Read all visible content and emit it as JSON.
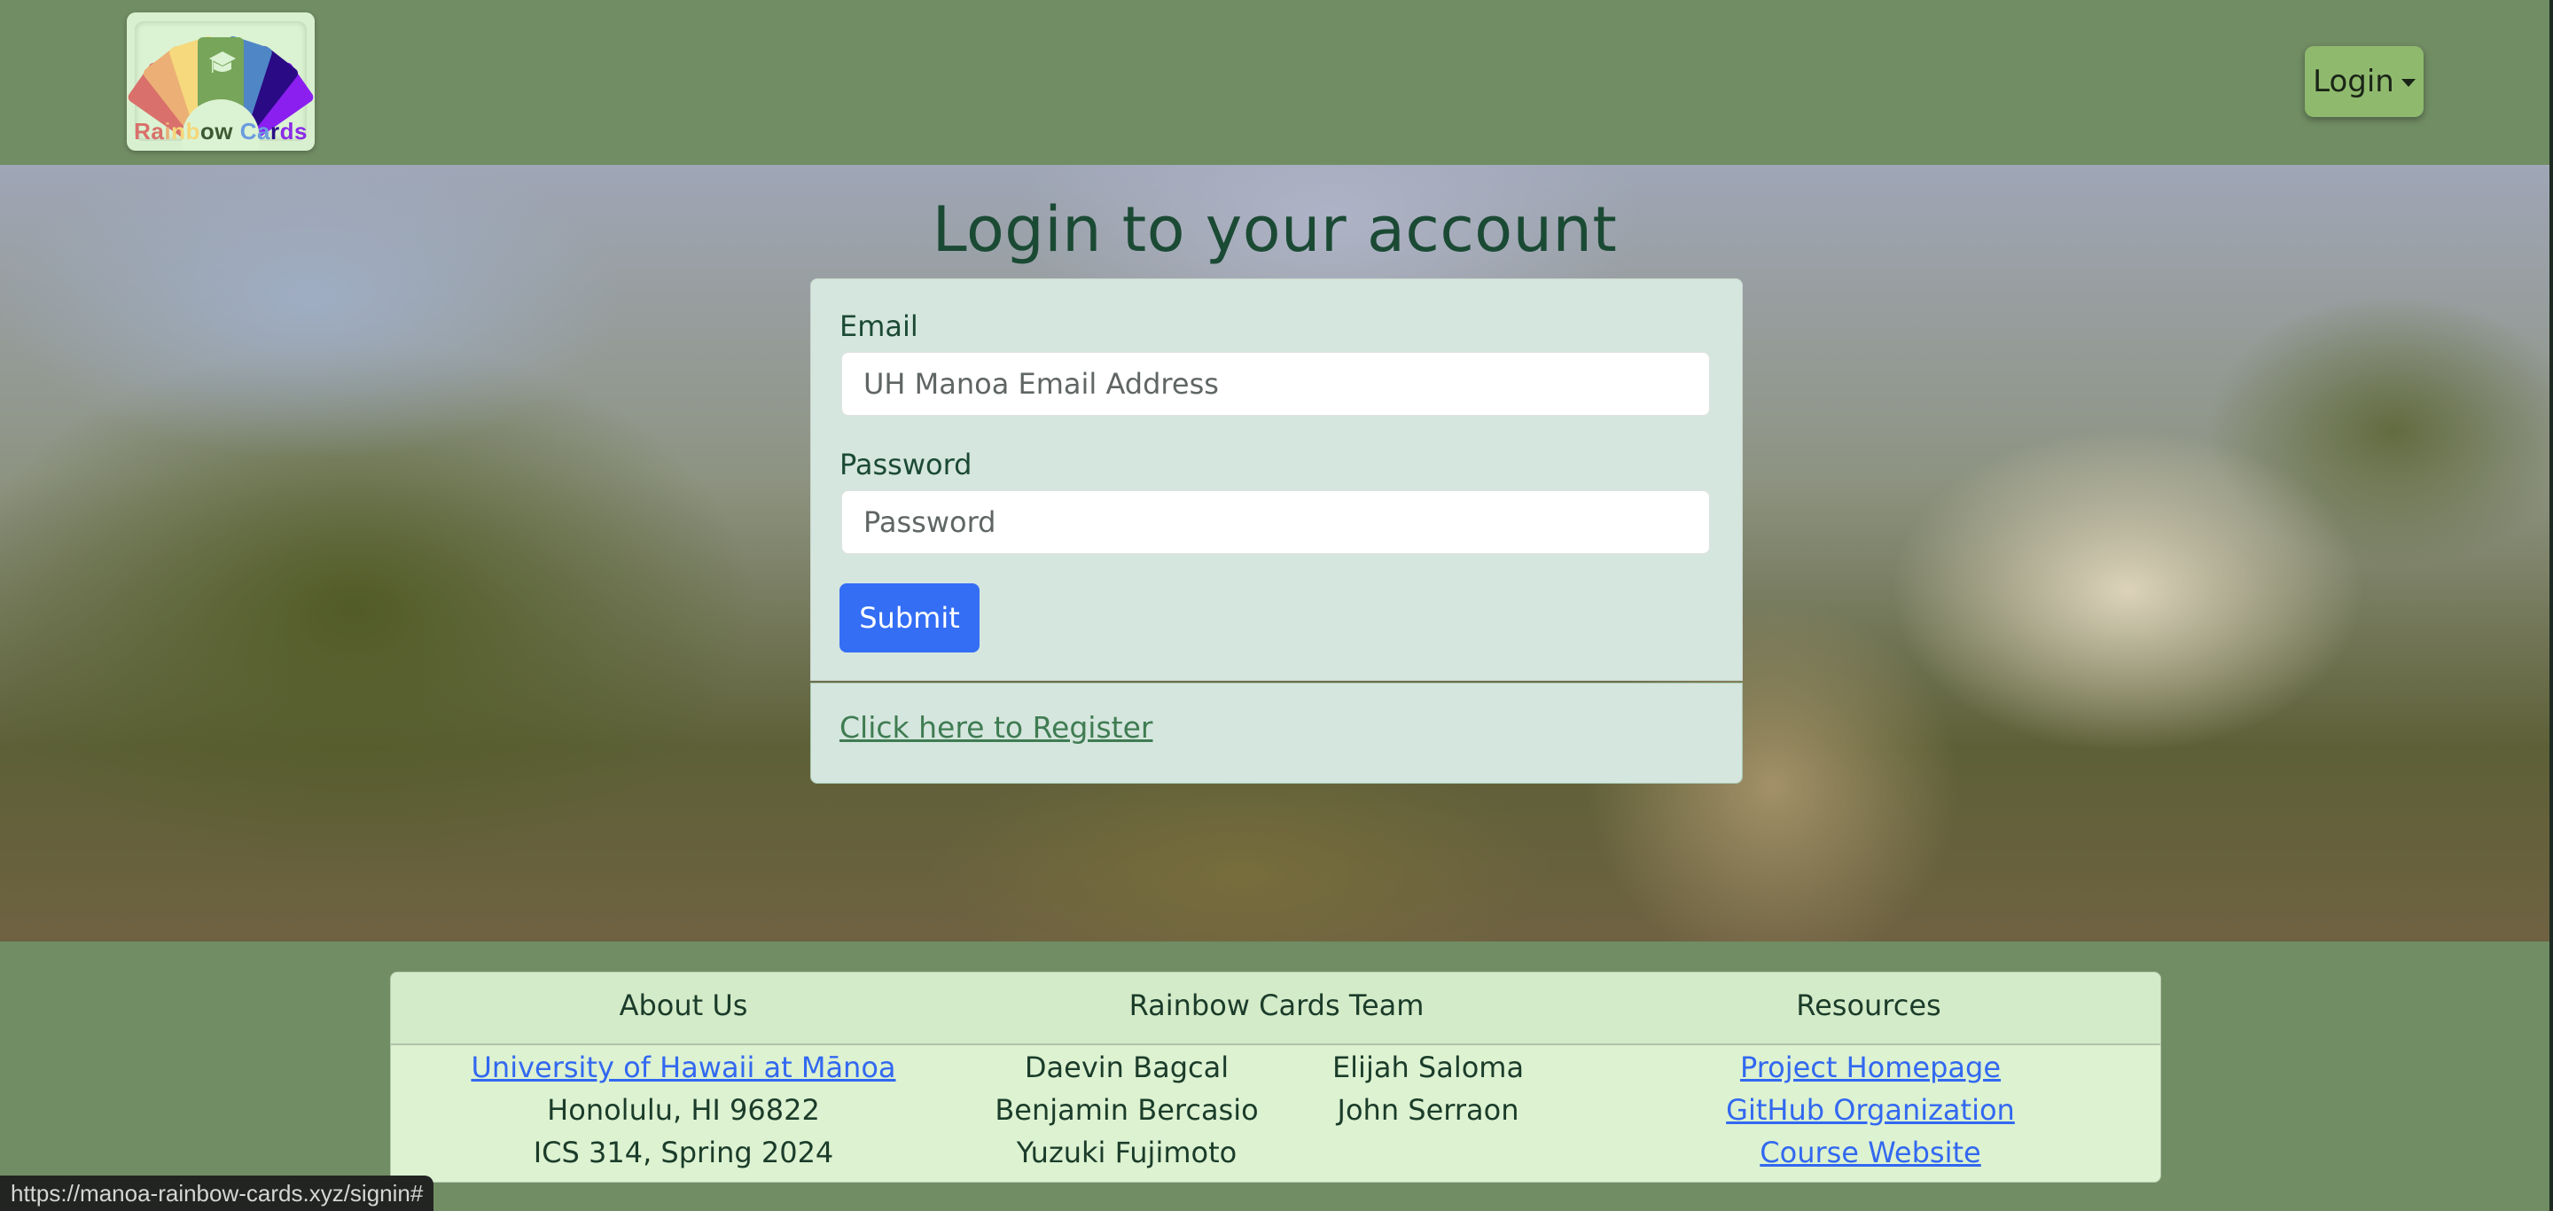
{
  "navbar": {
    "logo": {
      "text_parts": [
        {
          "t": "Ra",
          "color": "#d9706b"
        },
        {
          "t": "i",
          "color": "#e8b07a"
        },
        {
          "t": "n",
          "color": "#f5d77a"
        },
        {
          "t": "b",
          "color": "#f5d77a"
        },
        {
          "t": "ow ",
          "color": "#3d5a33"
        },
        {
          "t": "C",
          "color": "#6b9be0"
        },
        {
          "t": "a",
          "color": "#6b9be0"
        },
        {
          "t": "r",
          "color": "#2a1087"
        },
        {
          "t": "ds",
          "color": "#8b2be8"
        }
      ],
      "icon": "graduation-cap-icon",
      "card_colors": [
        "#d9706b",
        "#ecb076",
        "#f6d97c",
        "#77a55a",
        "#4f86c6",
        "#2a0a85",
        "#8a1ff0"
      ]
    },
    "login_menu_label": "Login"
  },
  "signin": {
    "title": "Login to your account",
    "email_label": "Email",
    "email_placeholder": "UH Manoa Email Address",
    "email_value": "",
    "password_label": "Password",
    "password_placeholder": "Password",
    "password_value": "",
    "submit_label": "Submit",
    "register_link": "Click here to Register"
  },
  "footer": {
    "about": {
      "heading": "About Us",
      "link": "University of Hawaii at Mānoa",
      "lines": [
        "Honolulu, HI 96822",
        "ICS 314, Spring 2024"
      ]
    },
    "team": {
      "heading": "Rainbow Cards Team",
      "members_col1": [
        "Daevin Bagcal",
        "Benjamin Bercasio",
        "Yuzuki Fujimoto"
      ],
      "members_col2": [
        "Elijah Saloma",
        "John Serraon"
      ]
    },
    "resources": {
      "heading": "Resources",
      "links": [
        "Project Homepage",
        "GitHub Organization",
        "Course Website"
      ]
    }
  },
  "status_bar_url": "https://manoa-rainbow-cards.xyz/signin#",
  "colors": {
    "navbar_bg": "#718d64",
    "login_button": "#8fba6e",
    "submit_button": "#336ef5",
    "card_bg": "#d5e6de",
    "footer_bg": "#dcf2d1",
    "link_blue": "#3268f0",
    "register_link": "#3f7c52",
    "heading_text": "#1b4a34"
  }
}
